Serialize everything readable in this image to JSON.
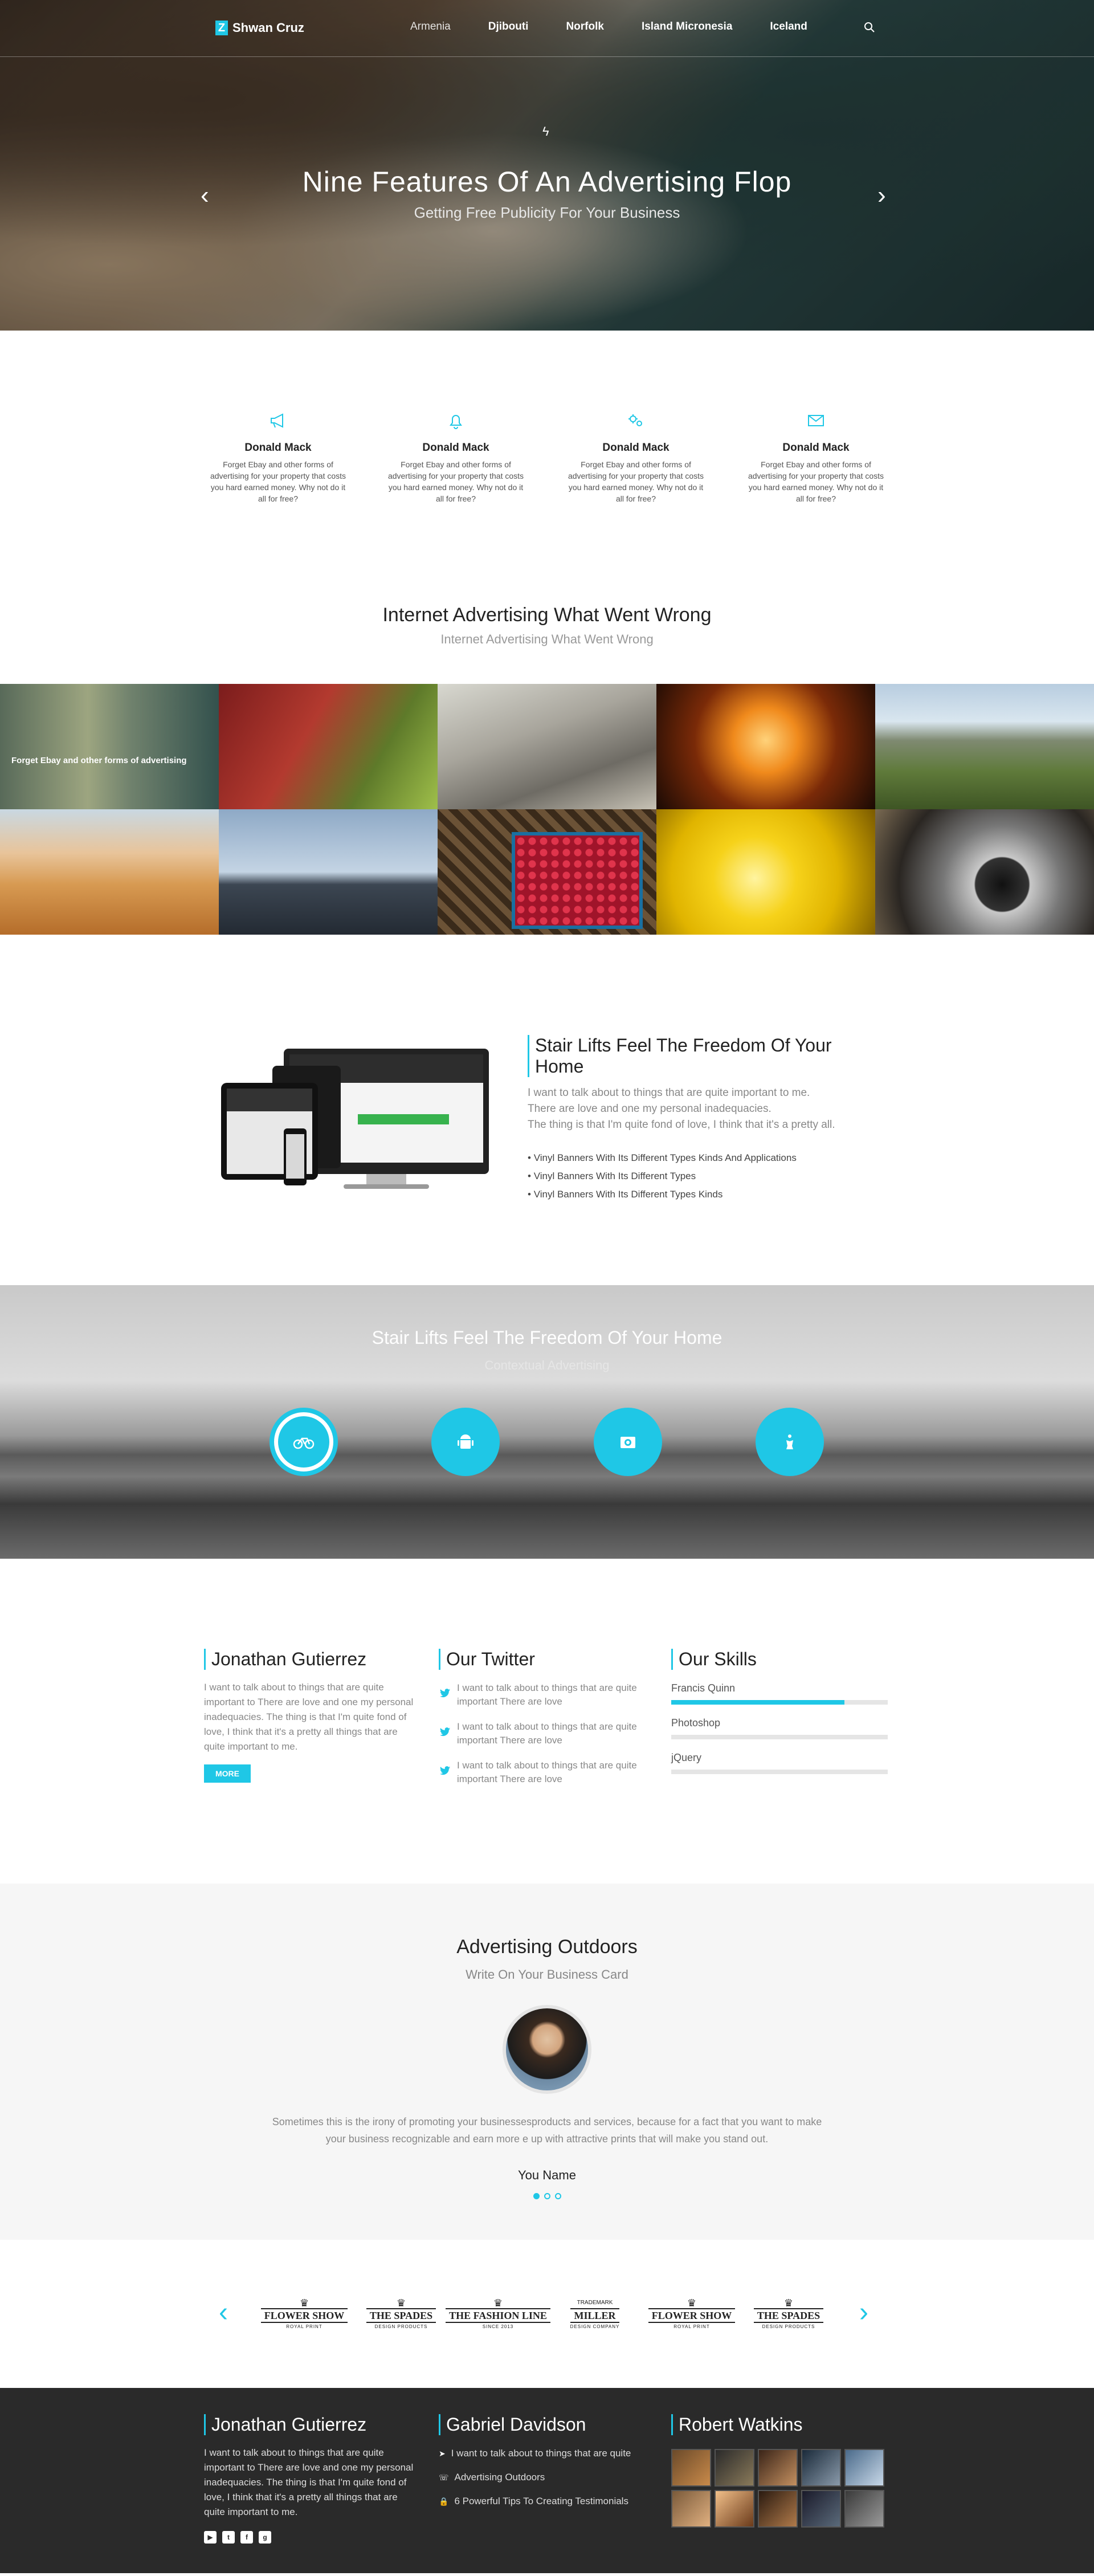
{
  "nav": {
    "brand": "Shwan Cruz",
    "logo_mark": "Z",
    "items": [
      "Armenia",
      "Djibouti",
      "Norfolk",
      "Island Micronesia",
      "Iceland"
    ]
  },
  "hero": {
    "title": "Nine Features Of An Advertising Flop",
    "subtitle": "Getting Free Publicity For Your Business",
    "bolt_icon": "ϟ",
    "prev": "‹",
    "next": "›"
  },
  "features": [
    {
      "icon": "megaphone-icon",
      "name": "Donald Mack",
      "text": "Forget Ebay and other forms of advertising for your property that costs you hard earned money. Why not do it all for free?"
    },
    {
      "icon": "bell-icon",
      "name": "Donald Mack",
      "text": "Forget Ebay and other forms of advertising for your property that costs you hard earned money. Why not do it all for free?"
    },
    {
      "icon": "gears-icon",
      "name": "Donald Mack",
      "text": "Forget Ebay and other forms of advertising for your property that costs you hard earned money. Why not do it all for free?"
    },
    {
      "icon": "envelope-icon",
      "name": "Donald Mack",
      "text": "Forget Ebay and other forms of advertising for your property that costs you hard earned money. Why not do it all for free?"
    }
  ],
  "gallery": {
    "title": "Internet Advertising What Went Wrong",
    "subtitle": "Internet Advertising What Went Wrong",
    "hover_caption": "Forget Ebay and other forms of advertising"
  },
  "device_section": {
    "title": "Stair Lifts Feel The Freedom Of Your Home",
    "body_1": "I want to talk about to things that are quite important to me.",
    "body_2": "There are love and one my personal inadequacies.",
    "body_3": "The thing is that I'm quite fond of love, I think that it's a pretty all.",
    "list": [
      "Vinyl Banners With Its Different Types Kinds And Applications",
      "Vinyl Banners With Its Different Types",
      "Vinyl Banners With Its Different Types Kinds"
    ]
  },
  "band": {
    "title": "Stair Lifts Feel The Freedom Of Your Home",
    "subtitle": "Contextual Advertising",
    "icons": [
      "bicycle-icon",
      "android-icon",
      "camera-icon",
      "chess-icon"
    ]
  },
  "about": {
    "title": "Jonathan Gutierrez",
    "text": "I want to talk about to things that are quite important to There are love and one my personal inadequacies. The thing is that I'm quite fond of love, I think that it's a pretty all things that are quite important to me.",
    "button": "MORE"
  },
  "twitter": {
    "title": "Our Twitter",
    "tweets": [
      "I want to talk about to things that are quite important There are love",
      "I want to talk about to things that are quite important There are love",
      "I want to talk about to things that are quite important There are love"
    ]
  },
  "skills": {
    "title": "Our Skills",
    "items": [
      {
        "label": "Francis Quinn",
        "level": 0.8
      },
      {
        "label": "Photoshop",
        "level": 0
      },
      {
        "label": "jQuery",
        "level": 0
      }
    ]
  },
  "testimonial": {
    "title": "Advertising Outdoors",
    "subtitle": "Write On Your Business Card",
    "quote": "Sometimes this is the irony of promoting your businessesproducts and services, because for a fact that you want to make your business recognizable and earn more e up with attractive prints that will make you stand out.",
    "name": "You Name"
  },
  "logos": [
    {
      "top": "♛",
      "word": "FLOWER SHOW",
      "tiny": "ROYAL PRINT"
    },
    {
      "top": "♛",
      "word": "THE SPADES",
      "tiny": "DESIGN PRODUCTS"
    },
    {
      "top": "♛",
      "word": "THE FASHION LINE",
      "tiny": "SINCE 2013"
    },
    {
      "top": "TRADEMARK",
      "word": "MILLER",
      "tiny": "DESIGN COMPANY"
    },
    {
      "top": "♛",
      "word": "FLOWER SHOW",
      "tiny": "ROYAL PRINT"
    },
    {
      "top": "♛",
      "word": "THE SPADES",
      "tiny": "DESIGN PRODUCTS"
    }
  ],
  "footer": {
    "col1_title": "Jonathan Gutierrez",
    "col1_text": "I want to talk about to things that are quite important to There are love and one my personal inadequacies. The thing is that I'm quite fond of love, I think that it's a pretty all things that are quite important to me.",
    "col2_title": "Gabriel Davidson",
    "links": [
      {
        "icon": "➤",
        "text": "I want to talk about to things that are quite"
      },
      {
        "icon": "☏",
        "text": "Advertising Outdoors"
      },
      {
        "icon": "🔒",
        "text": "6 Powerful Tips To Creating Testimonials"
      }
    ],
    "col3_title": "Robert Watkins",
    "social": [
      "▶",
      "t",
      "f",
      "g"
    ]
  },
  "colors": {
    "accent": "#1fc7e6",
    "footer_bg": "#2a2a2a"
  }
}
